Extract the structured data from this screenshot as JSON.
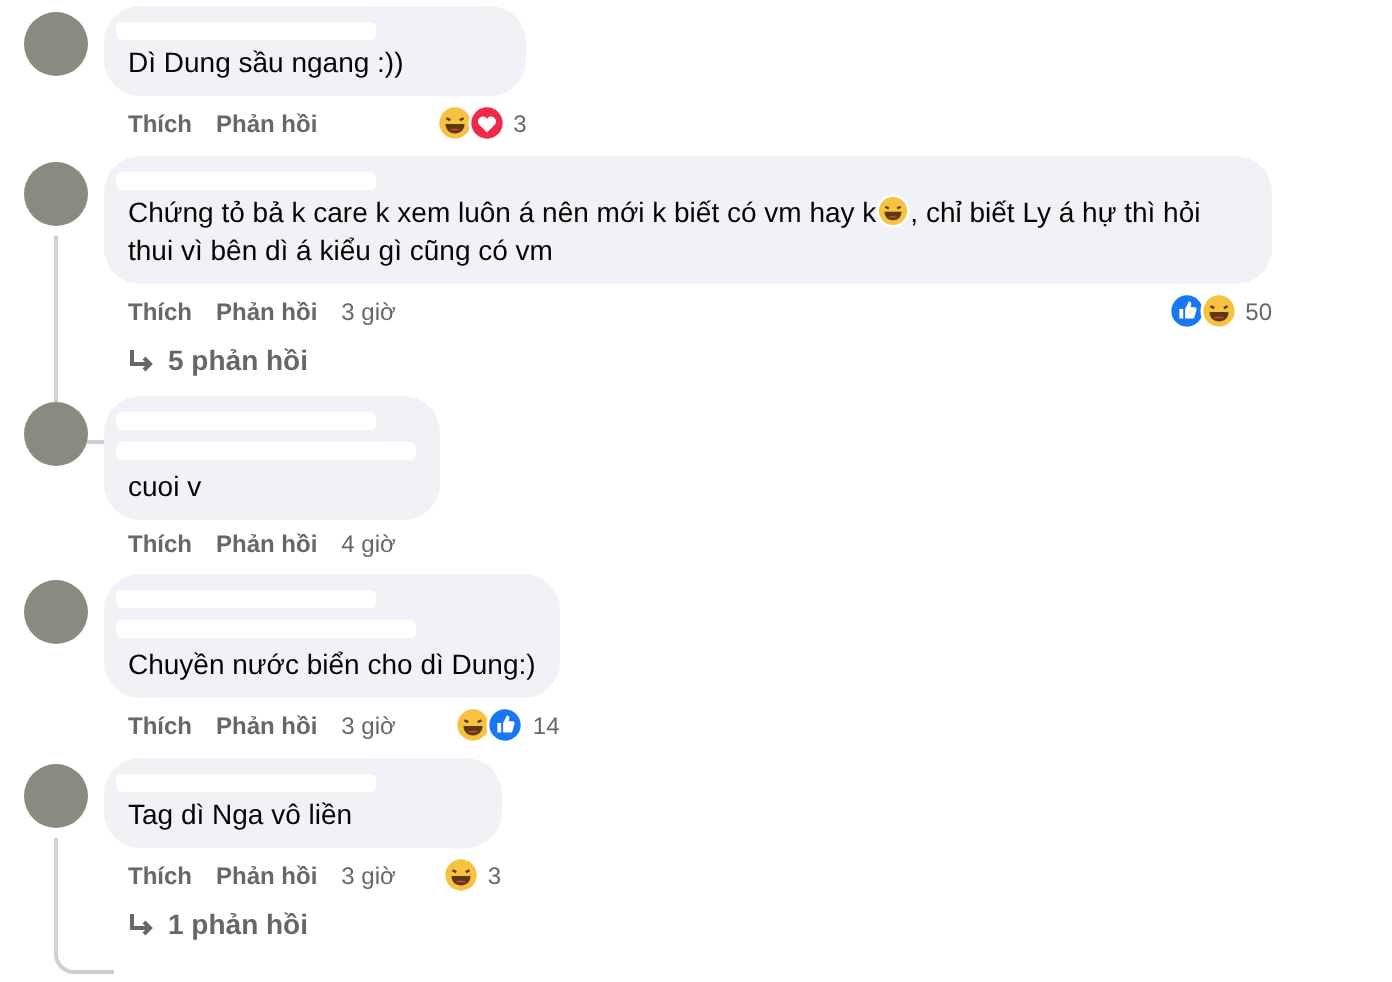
{
  "comments": [
    {
      "text": [
        "Dì Dung sầu ngang :))"
      ],
      "actions": [
        "Thích",
        "Phản hồi"
      ],
      "reactions": [
        {
          "kind": "haha"
        },
        {
          "kind": "love"
        }
      ],
      "reaction_count": "3"
    },
    {
      "text": [
        "Chứng tỏ bả k care k xem luôn á nên mới k biết có vm hay k",
        ", chỉ biết Ly á hự thì hỏi thui vì bên dì á kiểu gì cũng có vm"
      ],
      "actions": [
        "Thích",
        "Phản hồi"
      ],
      "time": "3 giờ",
      "reactions": [
        {
          "kind": "like"
        },
        {
          "kind": "haha"
        }
      ],
      "reaction_count": "50",
      "replies": "5 phản hồi"
    },
    {
      "redacted_line": true,
      "text": [
        "cuoi v"
      ],
      "actions": [
        "Thích",
        "Phản hồi"
      ],
      "time": "4 giờ"
    },
    {
      "redacted_line": true,
      "text": [
        "Chuyền nước biển cho dì Dung:)"
      ],
      "actions": [
        "Thích",
        "Phản hồi"
      ],
      "time": "3 giờ",
      "reactions": [
        {
          "kind": "haha"
        },
        {
          "kind": "like"
        }
      ],
      "reaction_count": "14"
    },
    {
      "text": [
        "Tag dì Nga vô liền"
      ],
      "actions": [
        "Thích",
        "Phản hồi"
      ],
      "time": "3 giờ",
      "reactions": [
        {
          "kind": "haha"
        }
      ],
      "reaction_count": "3",
      "replies": "1 phản hồi"
    }
  ]
}
